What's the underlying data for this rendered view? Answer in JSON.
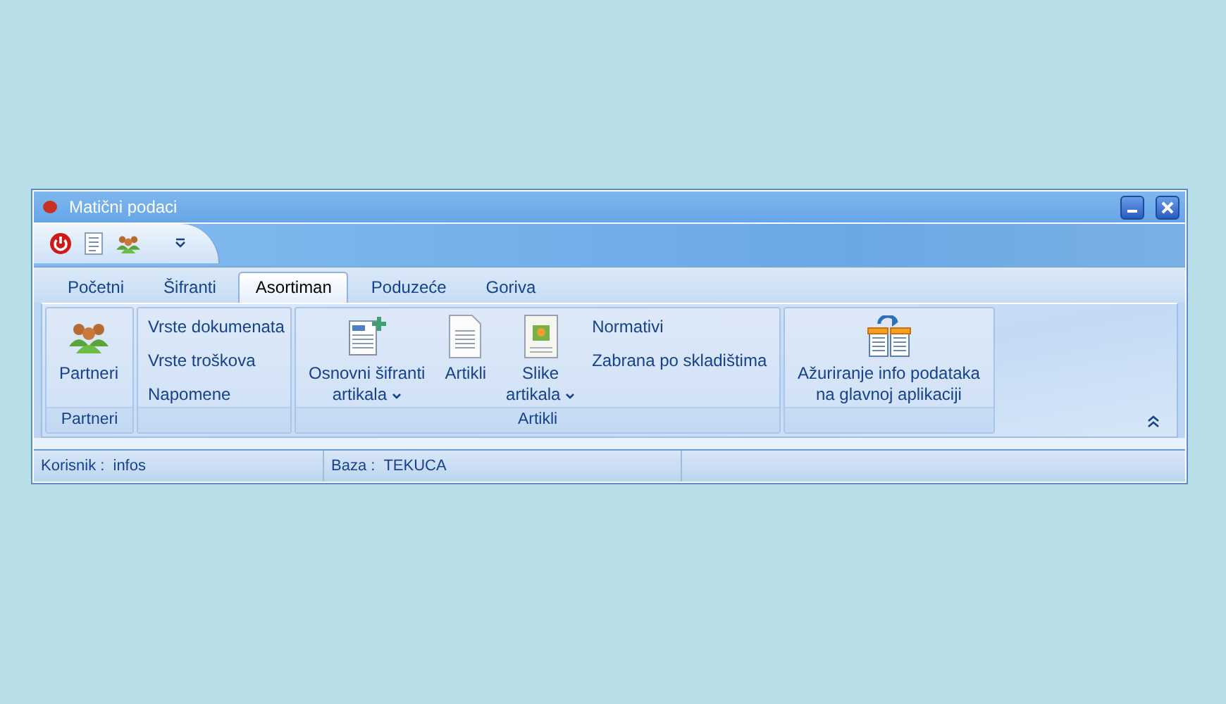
{
  "window": {
    "title": "Matični podaci"
  },
  "tabs": [
    {
      "label": "Početni",
      "selected": false
    },
    {
      "label": "Šifranti",
      "selected": false
    },
    {
      "label": "Asortiman",
      "selected": true
    },
    {
      "label": "Poduzeće",
      "selected": false
    },
    {
      "label": "Goriva",
      "selected": false
    }
  ],
  "groups": [
    {
      "label": "Partneri",
      "items": [
        {
          "kind": "large",
          "lines": [
            "Partneri"
          ],
          "dropdown": false
        }
      ]
    },
    {
      "items": [
        {
          "kind": "small",
          "lines": [
            "Vrste dokumenata"
          ]
        },
        {
          "kind": "small",
          "lines": [
            "Vrste troškova"
          ]
        },
        {
          "kind": "small",
          "lines": [
            "Napomene"
          ]
        }
      ]
    },
    {
      "label": "Artikli",
      "items": [
        {
          "kind": "large",
          "lines": [
            "Osnovni šifranti",
            "artikala"
          ],
          "dropdown": true
        },
        {
          "kind": "large",
          "lines": [
            "Artikli"
          ],
          "dropdown": false
        },
        {
          "kind": "large",
          "lines": [
            "Slike",
            "artikala"
          ],
          "dropdown": true
        },
        {
          "kind": "small",
          "lines": [
            "Normativi"
          ]
        },
        {
          "kind": "small",
          "lines": [
            "Zabrana po skladištima"
          ]
        }
      ]
    },
    {
      "items": [
        {
          "kind": "large",
          "lines": [
            "Ažuriranje info podataka",
            "na glavnoj aplikaciji"
          ],
          "dropdown": false
        }
      ]
    }
  ],
  "status_bar": [
    {
      "label": "Korisnik :",
      "value": "infos"
    },
    {
      "label": "Baza :",
      "value": "TEKUCA"
    }
  ]
}
